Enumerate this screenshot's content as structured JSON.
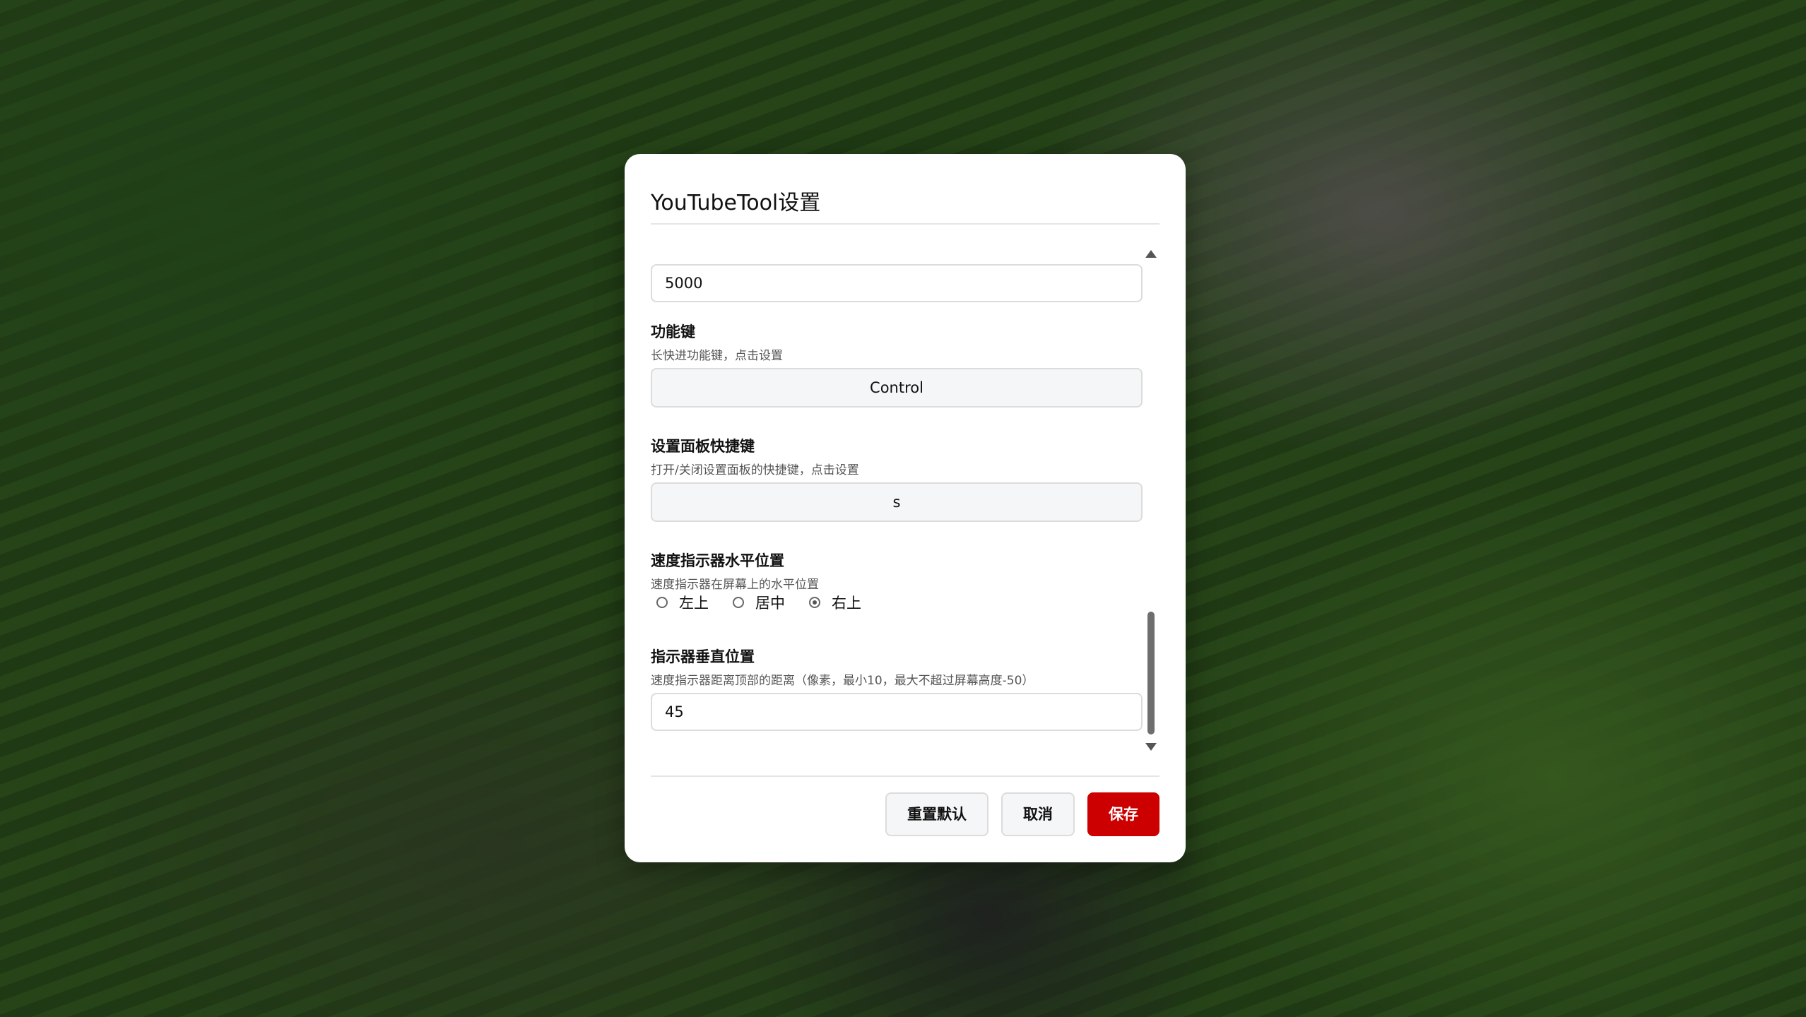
{
  "dialog": {
    "title": "YouTubeTool设置"
  },
  "fields": {
    "top_input_value": "5000",
    "modifier_key": {
      "label": "功能键",
      "description": "长快进功能键，点击设置",
      "value": "Control"
    },
    "panel_shortcut": {
      "label": "设置面板快捷键",
      "description": "打开/关闭设置面板的快捷键，点击设置",
      "value": "s"
    },
    "indicator_horizontal": {
      "label": "速度指示器水平位置",
      "description": "速度指示器在屏幕上的水平位置",
      "options": [
        "左上",
        "居中",
        "右上"
      ],
      "selected": "右上"
    },
    "indicator_vertical": {
      "label": "指示器垂直位置",
      "description": "速度指示器距离顶部的距离（像素，最小10，最大不超过屏幕高度-50）",
      "value": "45"
    }
  },
  "footer": {
    "reset_label": "重置默认",
    "cancel_label": "取消",
    "save_label": "保存"
  },
  "colors": {
    "accent": "#cc0000"
  },
  "icons": {
    "scroll_up": "triangle-up-icon",
    "scroll_down": "triangle-down-icon"
  }
}
